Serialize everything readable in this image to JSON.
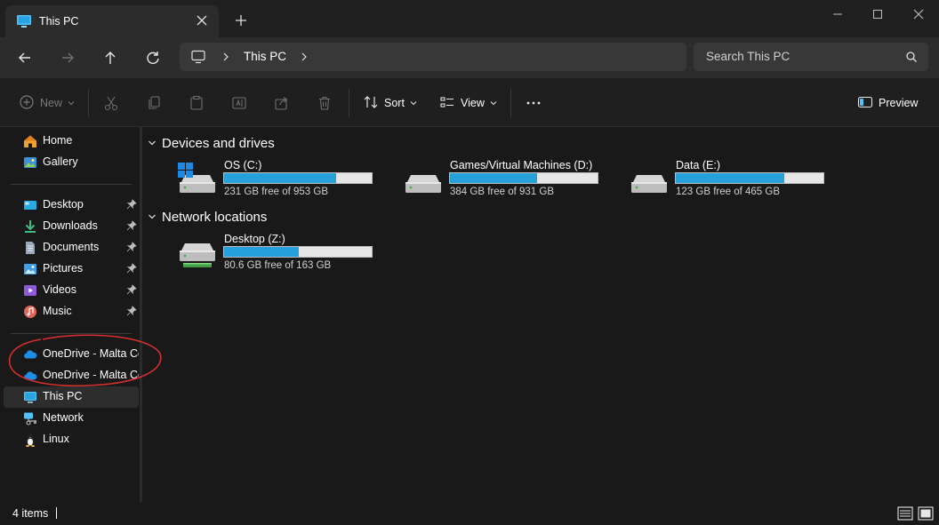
{
  "window": {
    "tab_title": "This PC",
    "colors": {
      "accent": "#26a0da",
      "background": "#191919",
      "annotation": "#d32f2f"
    }
  },
  "nav": {
    "breadcrumb": [
      "This PC"
    ],
    "search_placeholder": "Search This PC"
  },
  "toolbar": {
    "new_label": "New",
    "sort_label": "Sort",
    "view_label": "View",
    "preview_label": "Preview"
  },
  "sidebar": {
    "top": [
      {
        "label": "Home",
        "icon": "home-icon"
      },
      {
        "label": "Gallery",
        "icon": "gallery-icon"
      }
    ],
    "quick_access": [
      {
        "label": "Desktop",
        "icon": "desktop-folder-icon",
        "pinned": true
      },
      {
        "label": "Downloads",
        "icon": "downloads-icon",
        "pinned": true
      },
      {
        "label": "Documents",
        "icon": "documents-icon",
        "pinned": true
      },
      {
        "label": "Pictures",
        "icon": "pictures-icon",
        "pinned": true
      },
      {
        "label": "Videos",
        "icon": "videos-icon",
        "pinned": true
      },
      {
        "label": "Music",
        "icon": "music-icon",
        "pinned": true
      }
    ],
    "locations": [
      {
        "label": "OneDrive - Malta Co",
        "icon": "onedrive-icon"
      },
      {
        "label": "OneDrive - Malta Co",
        "icon": "onedrive-icon"
      },
      {
        "label": "This PC",
        "icon": "this-pc-icon",
        "selected": true
      },
      {
        "label": "Network",
        "icon": "network-icon"
      },
      {
        "label": "Linux",
        "icon": "linux-icon"
      }
    ]
  },
  "content": {
    "devices_heading": "Devices and drives",
    "network_heading": "Network locations",
    "drives": [
      {
        "name": "OS (C:)",
        "free": "231 GB free of 953 GB",
        "used_fraction": 0.758,
        "icon": "windows-drive-icon"
      },
      {
        "name": "Games/Virtual Machines (D:)",
        "free": "384 GB free of 931 GB",
        "used_fraction": 0.588,
        "icon": "drive-icon"
      },
      {
        "name": "Data (E:)",
        "free": "123 GB free of 465 GB",
        "used_fraction": 0.735,
        "icon": "drive-icon"
      }
    ],
    "network_drives": [
      {
        "name": "Desktop (Z:)",
        "free": "80.6 GB free of 163 GB",
        "used_fraction": 0.505,
        "icon": "network-drive-icon"
      }
    ]
  },
  "status": {
    "item_count": "4 items"
  }
}
